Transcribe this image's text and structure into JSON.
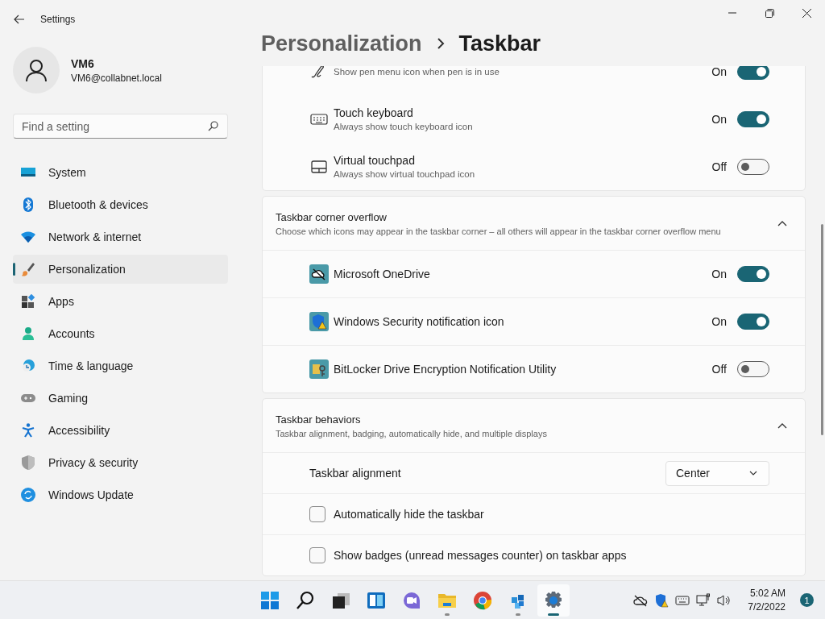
{
  "window": {
    "title": "Settings"
  },
  "user": {
    "name": "VM6",
    "email": "VM6@collabnet.local"
  },
  "search": {
    "placeholder": "Find a setting"
  },
  "nav": [
    {
      "label": "System",
      "selected": false
    },
    {
      "label": "Bluetooth & devices",
      "selected": false
    },
    {
      "label": "Network & internet",
      "selected": false
    },
    {
      "label": "Personalization",
      "selected": true
    },
    {
      "label": "Apps",
      "selected": false
    },
    {
      "label": "Accounts",
      "selected": false
    },
    {
      "label": "Time & language",
      "selected": false
    },
    {
      "label": "Gaming",
      "selected": false
    },
    {
      "label": "Accessibility",
      "selected": false
    },
    {
      "label": "Privacy & security",
      "selected": false
    },
    {
      "label": "Windows Update",
      "selected": false
    }
  ],
  "breadcrumb": {
    "parent": "Personalization",
    "current": "Taskbar"
  },
  "sections": [
    {
      "rows": [
        {
          "kind": "toggle",
          "description": "Show pen menu icon when pen is in use",
          "state_label": "On",
          "on": true
        },
        {
          "kind": "toggle",
          "title": "Touch keyboard",
          "description": "Always show touch keyboard icon",
          "state_label": "On",
          "on": true
        },
        {
          "kind": "toggle",
          "title": "Virtual touchpad",
          "description": "Always show virtual touchpad icon",
          "state_label": "Off",
          "on": false
        }
      ]
    },
    {
      "title": "Taskbar corner overflow",
      "description": "Choose which icons may appear in the taskbar corner – all others will appear in the taskbar corner overflow menu",
      "expanded": true,
      "rows": [
        {
          "kind": "toggle",
          "title": "Microsoft OneDrive",
          "state_label": "On",
          "on": true
        },
        {
          "kind": "toggle",
          "title": "Windows Security notification icon",
          "state_label": "On",
          "on": true
        },
        {
          "kind": "toggle",
          "title": "BitLocker Drive Encryption Notification Utility",
          "state_label": "Off",
          "on": false
        }
      ]
    },
    {
      "title": "Taskbar behaviors",
      "description": "Taskbar alignment, badging, automatically hide, and multiple displays",
      "expanded": true,
      "rows": [
        {
          "kind": "dropdown",
          "title": "Taskbar alignment",
          "value": "Center"
        },
        {
          "kind": "checkbox",
          "title": "Automatically hide the taskbar",
          "checked": false
        },
        {
          "kind": "checkbox",
          "title": "Show badges (unread messages counter) on taskbar apps",
          "checked": false
        }
      ]
    }
  ],
  "taskbar": {
    "apps": [
      {
        "running": false,
        "active": false
      },
      {
        "running": false,
        "active": false
      },
      {
        "running": false,
        "active": false
      },
      {
        "running": false,
        "active": false
      },
      {
        "running": false,
        "active": false
      },
      {
        "running": true,
        "active": false
      },
      {
        "running": false,
        "active": false
      },
      {
        "running": true,
        "active": false
      },
      {
        "running": true,
        "active": true
      }
    ],
    "time": "5:02 AM",
    "date": "7/2/2022",
    "notifications": "1"
  }
}
